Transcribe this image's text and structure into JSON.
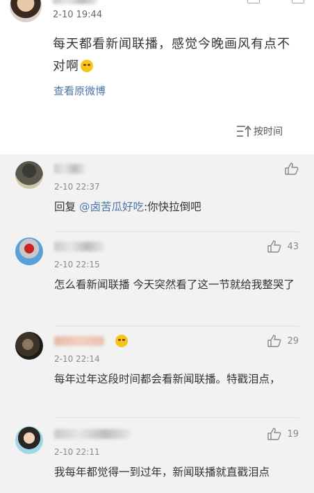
{
  "post": {
    "time": "2-10 19:44",
    "text": "每天都看新闻联播，感觉今晚画风有点不对啊",
    "view_original": "查看原微博",
    "sort_label": "按时间"
  },
  "comments": [
    {
      "time": "2-10 22:37",
      "reply_prefix": "回复 ",
      "mention": "@卤苦瓜好吃",
      "text": ":你快拉倒吧",
      "likes": ""
    },
    {
      "time": "2-10 22:15",
      "text": "怎么看新闻联播 今天突然看了这一节就给我整哭了",
      "likes": "43"
    },
    {
      "time": "2-10 22:14",
      "text": "每年过年这段时间都会看新闻联播。特戳泪点，",
      "likes": "29"
    },
    {
      "time": "2-10 22:11",
      "text": "我每年都觉得一到过年，新闻联播就直戳泪点",
      "likes": "19"
    }
  ],
  "icons": {
    "like": "thumbs-up-icon",
    "sort": "sort-time-icon",
    "emoji": "laughing-emoji-icon"
  },
  "colors": {
    "link": "#4d74a8",
    "background": "#f2f2f2",
    "card": "#ffffff"
  }
}
